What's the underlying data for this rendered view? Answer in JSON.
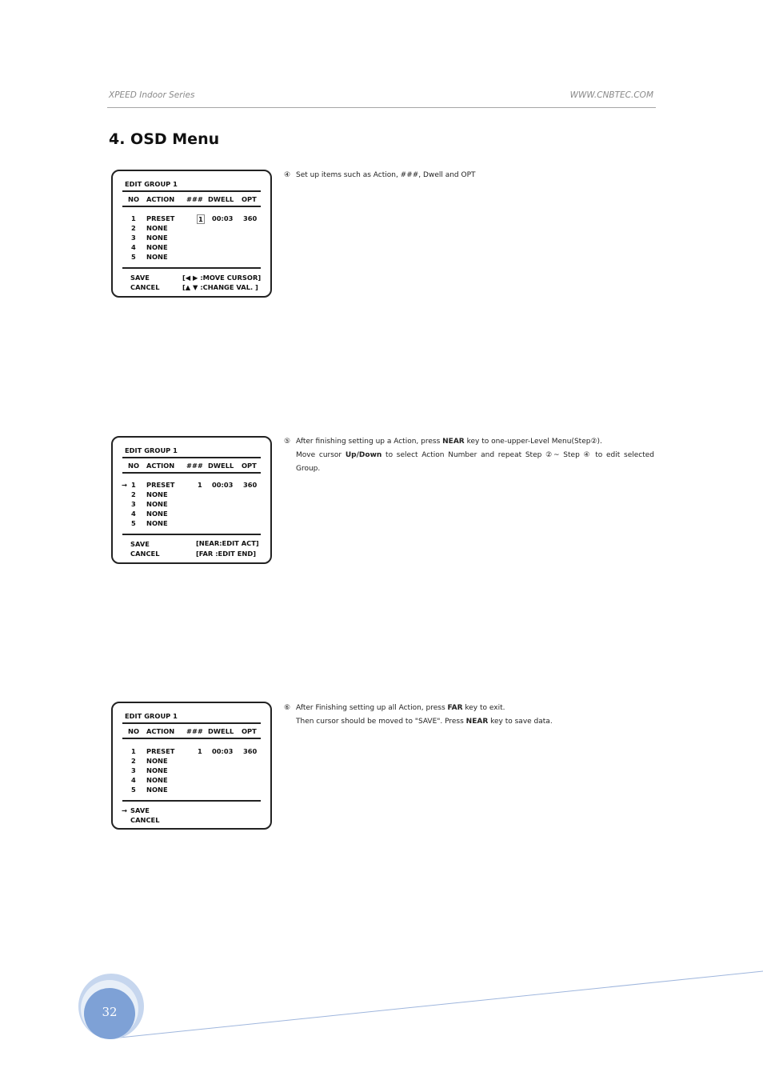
{
  "header": {
    "left": "XPEED Indoor Series",
    "right": "WWW.CNBTEC.COM"
  },
  "section_title": "4. OSD Menu",
  "osd_common": {
    "title": "EDIT GROUP 1",
    "col_no": "NO",
    "col_action": "ACTION",
    "col_hash": "###",
    "col_dwell": "DWELL",
    "col_opt": "OPT",
    "rows": [
      {
        "no": "1",
        "action": "PRESET",
        "hash": "1",
        "dwell": "00:03",
        "opt": "360"
      },
      {
        "no": "2",
        "action": "NONE"
      },
      {
        "no": "3",
        "action": "NONE"
      },
      {
        "no": "4",
        "action": "NONE"
      },
      {
        "no": "5",
        "action": "NONE"
      }
    ],
    "save": "SAVE",
    "cancel": "CANCEL",
    "cursor_arrow": "→"
  },
  "osd1": {
    "help1": "[◀ ▶ :MOVE CURSOR]",
    "help2": "[▲ ▼ :CHANGE VAL.  ]"
  },
  "osd2": {
    "help1": "[NEAR:EDIT ACT]",
    "help2": "[FAR   :EDIT END]"
  },
  "step4": {
    "num": "④",
    "text": "Set up items such as Action, ###, Dwell and OPT"
  },
  "step5": {
    "num": "⑤",
    "t1": "After finishing setting up a Action, press ",
    "b1": "NEAR",
    "t2": " key to one-upper-Level Menu(Step②).",
    "t3": "Move cursor ",
    "b2": "Up/Down",
    "t4": " to select Action Number and repeat Step ②~ Step ④ to edit selected Group."
  },
  "step6": {
    "num": "⑥",
    "t1": "After Finishing setting up all Action, press ",
    "b1": "FAR",
    "t2": " key to exit.",
    "t3": "Then cursor should be moved to \"SAVE\". Press ",
    "b2": "NEAR",
    "t4": " key to save data."
  },
  "page_number": "32",
  "colors": {
    "header_text": "#8a8a8a",
    "rule": "#a6a6a6",
    "page_circle": "#7ea1d6",
    "page_circle_outer": "#c6d6ee",
    "footer_line": "#9fb6dd"
  }
}
